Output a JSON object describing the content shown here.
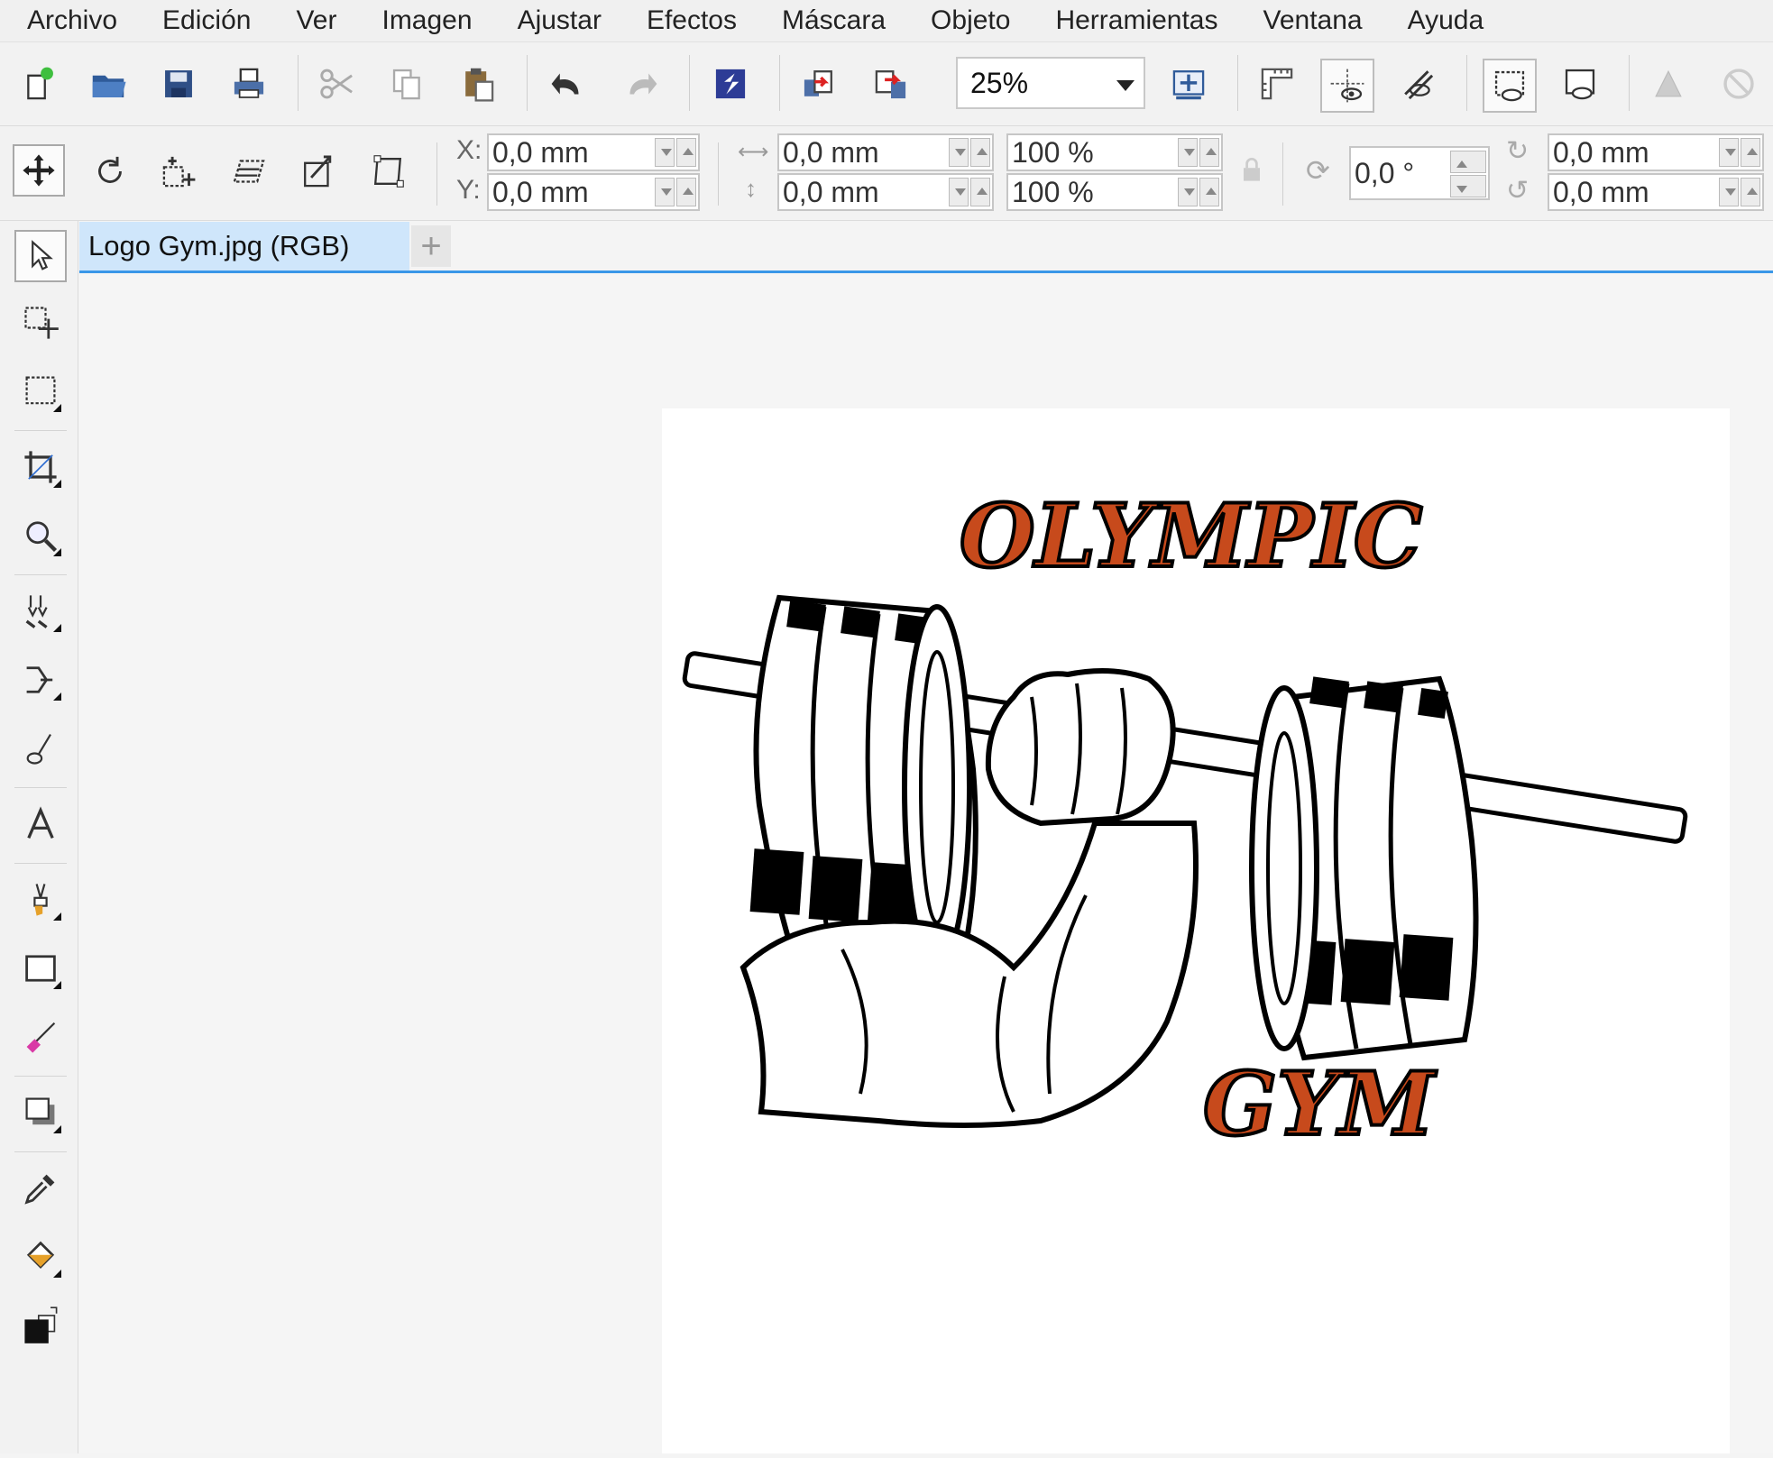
{
  "menu": [
    "Archivo",
    "Edición",
    "Ver",
    "Imagen",
    "Ajustar",
    "Efectos",
    "Máscara",
    "Objeto",
    "Herramientas",
    "Ventana",
    "Ayuda"
  ],
  "toolbar": {
    "zoom_value": "25%"
  },
  "property_bar": {
    "x_label": "X:",
    "x_value": "0,0 mm",
    "y_label": "Y:",
    "y_value": "0,0 mm",
    "width_value": "0,0 mm",
    "height_value": "0,0 mm",
    "scale_x": "100 %",
    "scale_y": "100 %",
    "angle_value": "0,0 °",
    "center_x": "0,0 mm",
    "center_y": "0,0 mm"
  },
  "document": {
    "tab_label": "Logo Gym.jpg (RGB)",
    "add_tab": "+"
  },
  "logo": {
    "top_text": "OLYMPIC",
    "bottom_text": "GYM"
  },
  "colors": {
    "accent": "#3a97e8",
    "logo_orange": "#c74a1c",
    "tab_active": "#cfe6fb"
  }
}
